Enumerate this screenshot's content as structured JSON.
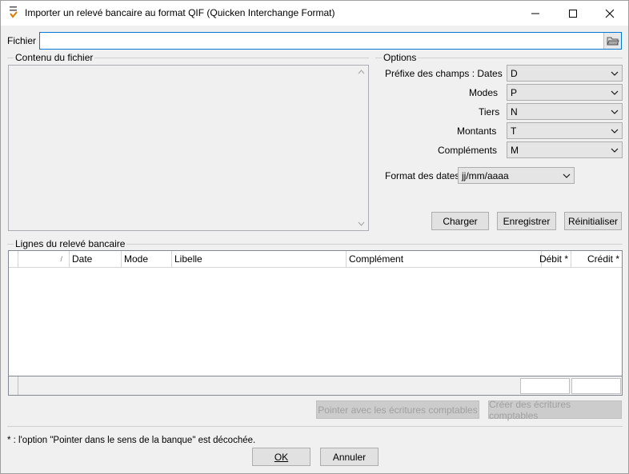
{
  "window": {
    "title": "Importer un relevé bancaire au format QIF (Quicken Interchange Format)"
  },
  "file": {
    "label": "Fichier",
    "value": ""
  },
  "content_group": {
    "legend": "Contenu du fichier"
  },
  "options": {
    "legend": "Options",
    "prefix_label": "Préfixe des champs : Dates",
    "fields": [
      {
        "label": "Modes",
        "value": "P"
      },
      {
        "label": "Tiers",
        "value": "N"
      },
      {
        "label": "Montants",
        "value": "T"
      },
      {
        "label": "Compléments",
        "value": "M"
      }
    ],
    "dates_value": "D",
    "date_format_label": "Format des dates",
    "date_format_value": "jj/mm/aaaa"
  },
  "buttons": {
    "charger": "Charger",
    "enregistrer": "Enregistrer",
    "reinitialiser": "Réinitialiser",
    "pointer": "Pointer avec les écritures comptables",
    "creer": "Créer des écritures comptables",
    "ok": "OK",
    "annuler": "Annuler"
  },
  "statement": {
    "legend": "Lignes du relevé bancaire",
    "columns": [
      "",
      "Date",
      "Mode",
      "Libelle",
      "Complément",
      "Débit *",
      "Crédit *"
    ],
    "sort_glyph": "/"
  },
  "footnote": "* : l'option \"Pointer dans le sens de la banque\" est décochée."
}
